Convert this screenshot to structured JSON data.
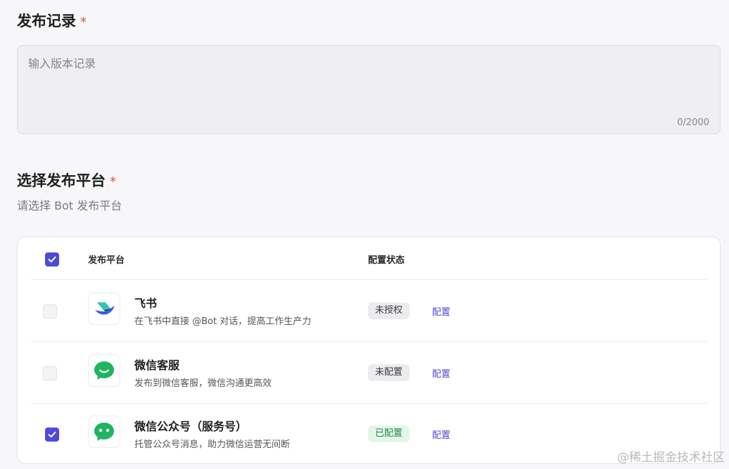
{
  "release_record": {
    "title": "发布记录",
    "required_mark": "*",
    "placeholder": "输入版本记录",
    "counter": "0/2000"
  },
  "platform_section": {
    "title": "选择发布平台",
    "required_mark": "*",
    "subtitle": "请选择 Bot 发布平台"
  },
  "table": {
    "header_all_checked": true,
    "col_platform": "发布平台",
    "col_status": "配置状态",
    "rows": [
      {
        "icon": "feishu-icon",
        "checked": false,
        "name": "飞书",
        "desc": "在飞书中直接 @Bot 对话，提高工作生产力",
        "status": "未授权",
        "status_color": "#ececef",
        "action": "配置"
      },
      {
        "icon": "wechat-customer-service-icon",
        "checked": false,
        "name": "微信客服",
        "desc": "发布到微信客服，微信沟通更高效",
        "status": "未配置",
        "status_color": "#ececef",
        "action": "配置"
      },
      {
        "icon": "wechat-official-account-icon",
        "checked": true,
        "name": "微信公众号（服务号）",
        "desc": "托管公众号消息，助力微信运营无间断",
        "status": "已配置",
        "status_color": "#e4f6ea",
        "action": "配置"
      }
    ]
  },
  "colors": {
    "accent": "#4e4bd8",
    "required": "#e5484d",
    "wechat_green": "#1fb560"
  },
  "watermark": "@稀土掘金技术社区"
}
